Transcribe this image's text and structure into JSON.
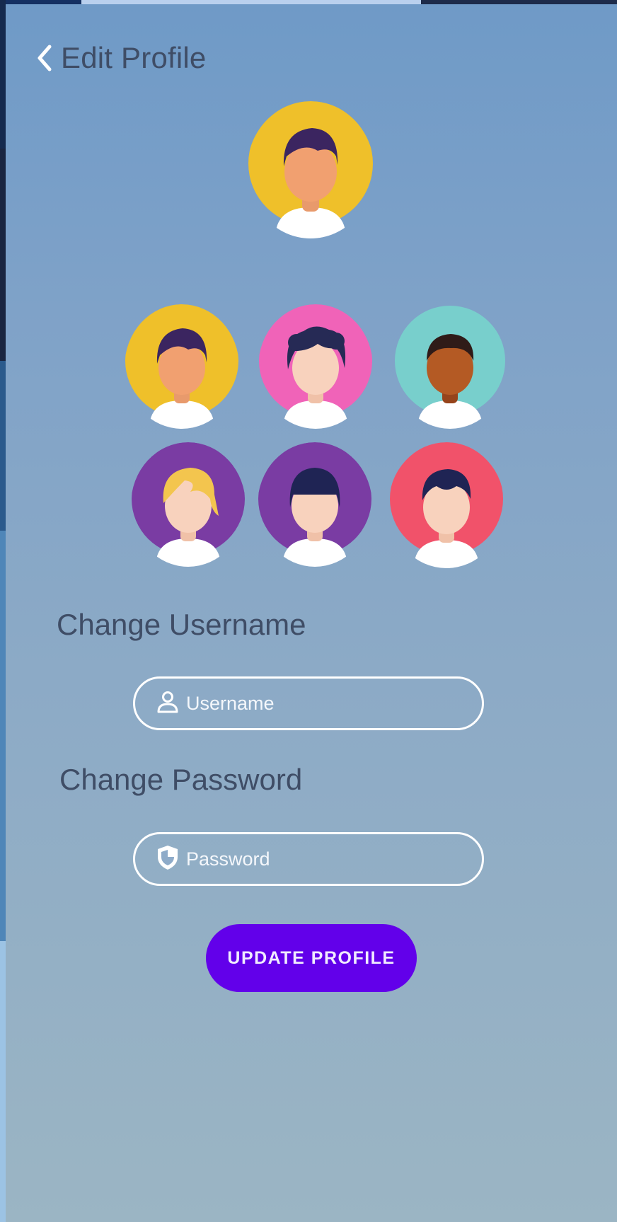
{
  "header": {
    "title": "Edit Profile",
    "back_icon": "chevron-left-icon"
  },
  "colors": {
    "accent": "#6200ea",
    "label_text": "#3f4d66",
    "avatar_yellow": "#efc02a",
    "avatar_pink": "#f063b8",
    "avatar_teal": "#78cfcc",
    "avatar_purple": "#7a3ca3",
    "avatar_red": "#f1526a"
  },
  "selected_avatar": {
    "name": "yellow-avatar"
  },
  "avatars": [
    {
      "name": "yellow-avatar"
    },
    {
      "name": "pink-avatar"
    },
    {
      "name": "teal-avatar"
    },
    {
      "name": "purple-blonde-avatar"
    },
    {
      "name": "purple-bangs-avatar"
    },
    {
      "name": "red-avatar"
    }
  ],
  "username_section": {
    "label": "Change Username",
    "placeholder": "Username",
    "icon": "user-icon"
  },
  "password_section": {
    "label": "Change Password",
    "placeholder": "Password",
    "icon": "shield-icon"
  },
  "update_button": {
    "label": "UPDATE PROFILE"
  }
}
